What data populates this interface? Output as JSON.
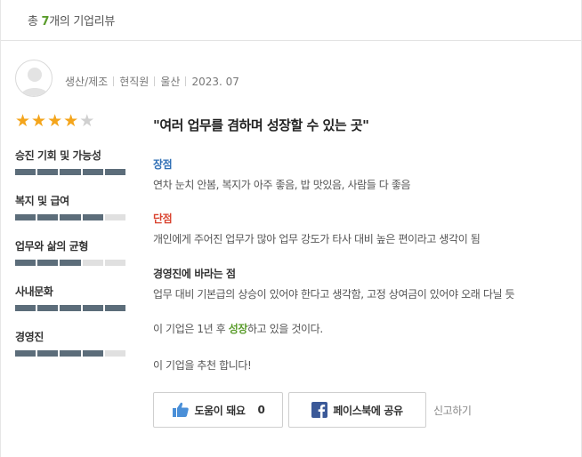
{
  "header": {
    "count_prefix": "총 ",
    "count_value": "7",
    "count_suffix": "개의 기업리뷰"
  },
  "review": {
    "meta": [
      "생산/제조",
      "현직원",
      "울산",
      "2023. 07"
    ],
    "rating": {
      "score": 4,
      "max": 5
    },
    "categories": [
      {
        "label": "승진 기회 및 가능성",
        "score": 5,
        "max": 5
      },
      {
        "label": "복지 및 급여",
        "score": 4,
        "max": 5
      },
      {
        "label": "업무와 삶의 균형",
        "score": 3,
        "max": 5
      },
      {
        "label": "사내문화",
        "score": 5,
        "max": 5
      },
      {
        "label": "경영진",
        "score": 4,
        "max": 5
      }
    ],
    "title": "\"여러 업무를 겸하며 성장할 수 있는 곳\"",
    "pros_heading": "장점",
    "pros_text": "연차 눈치 안봄, 복지가 아주 좋음, 밥 맛있음, 사람들 다 좋음",
    "cons_heading": "단점",
    "cons_text": "개인에게 주어진 업무가 많아 업무 강도가 타사 대비 높은 편이라고 생각이 됨",
    "wish_heading": "경영진에 바라는 점",
    "wish_text": "업무 대비 기본급의 상승이 있어야 한다고 생각함, 고정 상여금이 있어야 오래 다닐 듯",
    "predict_prefix": "이 기업은 1년 후 ",
    "predict_value": "성장",
    "predict_suffix": "하고 있을 것이다.",
    "recommend": "이 기업을 추천 합니다!"
  },
  "actions": {
    "helpful_label": "도움이 돼요",
    "helpful_count": "0",
    "facebook_label": "페이스북에 공유",
    "report_label": "신고하기"
  },
  "colors": {
    "accent_green": "#5a9c2b",
    "star": "#f4a51c",
    "bar_fill": "#5c6d7a",
    "pros_blue": "#2f6fb5",
    "cons_red": "#d9432f",
    "facebook": "#3b5998",
    "thumb": "#4a8fd8"
  },
  "icons": {
    "avatar": "user-avatar-icon",
    "helpful": "thumbs-up-icon",
    "facebook": "facebook-icon"
  }
}
